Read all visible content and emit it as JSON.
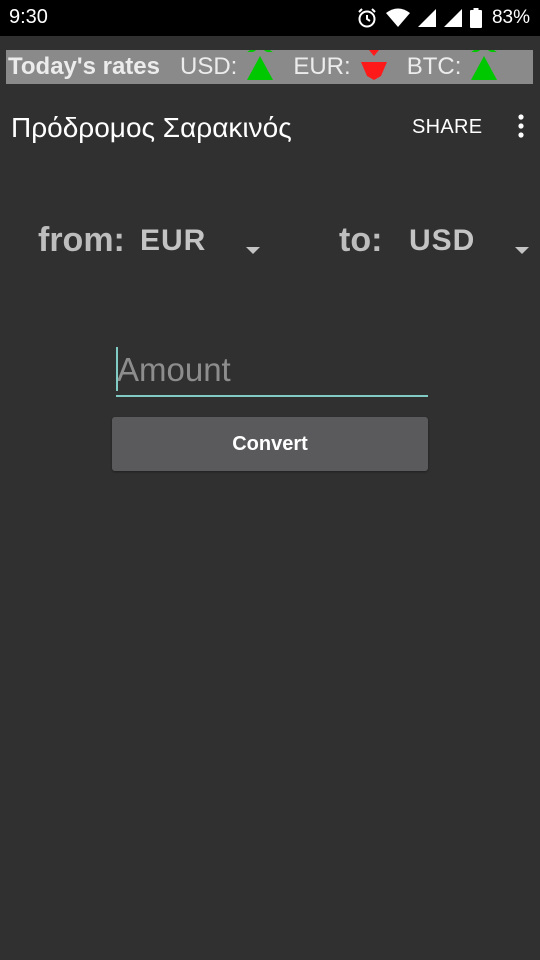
{
  "status_bar": {
    "time": "9:30",
    "battery_percent": "83%",
    "icons": [
      "alarm-icon",
      "wifi-icon",
      "cell-signal-icon",
      "cell-signal-icon",
      "battery-icon"
    ]
  },
  "rates_bar": {
    "title": "Today's rates",
    "items": [
      {
        "label": "USD:",
        "trend": "up",
        "color": "#00c800"
      },
      {
        "label": "EUR:",
        "trend": "down",
        "color": "#ff1a1a"
      },
      {
        "label": "BTC:",
        "trend": "up",
        "color": "#00c800"
      }
    ]
  },
  "app_bar": {
    "title": "Πρόδρομος Σαρακινός",
    "share_label": "SHARE",
    "overflow_icon": "more-vert-icon"
  },
  "converter": {
    "from_label": "from:",
    "from_value": "EUR",
    "to_label": "to:",
    "to_value": "USD",
    "amount_placeholder": "Amount",
    "amount_value": "",
    "convert_label": "Convert"
  },
  "colors": {
    "background": "#303030",
    "accent": "#80cbc4",
    "button": "#5a5a5c"
  }
}
